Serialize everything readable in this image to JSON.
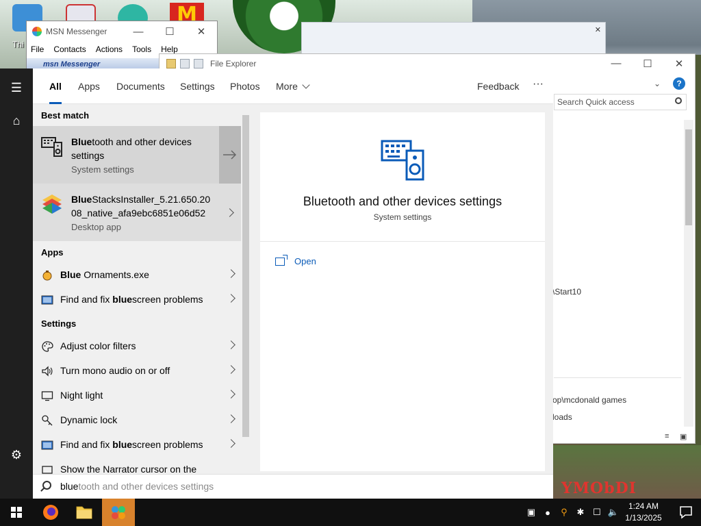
{
  "desktop": {
    "icon_label": "Thi",
    "wallpaper_sign": "YMObDI"
  },
  "msn_window": {
    "title": "MSN Messenger",
    "menu": [
      "File",
      "Contacts",
      "Actions",
      "Tools",
      "Help"
    ],
    "header": "msn Messenger"
  },
  "explorer": {
    "title": "File Explorer",
    "search_placeholder": "Search Quick access",
    "path_start10": "\\Start10",
    "path_mcdonald": "op\\mcdonald games",
    "path_downloads": "loads"
  },
  "search": {
    "tabs": [
      "All",
      "Apps",
      "Documents",
      "Settings",
      "Photos",
      "More"
    ],
    "feedback": "Feedback",
    "more_options": "···",
    "query_typed": "blue",
    "query_suggestion": "tooth and other devices settings",
    "best_match_header": "Best match",
    "best_match": [
      {
        "title_bold": "Blue",
        "title_rest": "tooth and other devices settings",
        "subtitle": "System settings"
      },
      {
        "title_bold": "Blue",
        "title_rest": "StacksInstaller_5.21.650.2008_native_afa9ebc6851e06d52",
        "subtitle": "Desktop app"
      }
    ],
    "apps_header": "Apps",
    "apps": [
      {
        "bold": "Blue",
        "rest": " Ornaments.exe",
        "bold_first": true
      },
      {
        "pre": "Find and fix ",
        "bold": "blue",
        "rest": "screen problems",
        "bold_first": false
      }
    ],
    "settings_header": "Settings",
    "settings": [
      {
        "pre": "Adjust color filters"
      },
      {
        "pre": "Turn mono audio on or off"
      },
      {
        "pre": "Night light"
      },
      {
        "pre": "Dynamic lock"
      },
      {
        "pre": "Find and fix ",
        "bold": "blue",
        "rest": "screen problems"
      },
      {
        "pre": "Show the Narrator cursor on the"
      }
    ],
    "preview": {
      "title": "Bluetooth and other devices settings",
      "subtitle": "System settings",
      "open_label": "Open"
    }
  },
  "taskbar": {
    "time": "1:24 AM",
    "date": "1/13/2025"
  },
  "colors": {
    "accent": "#0a5bb8",
    "rail": "#1f1f1f",
    "taskbar": "#101010"
  }
}
